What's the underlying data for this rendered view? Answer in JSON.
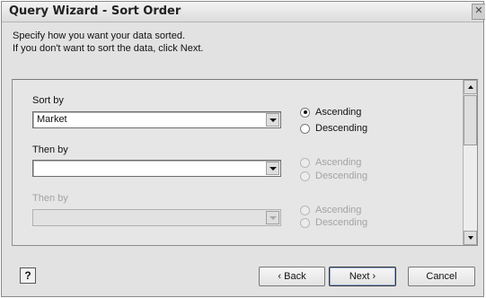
{
  "window": {
    "title": "Query Wizard - Sort Order",
    "close_glyph": "✕"
  },
  "instructions": {
    "line1": "Specify how you want your data sorted.",
    "line2": "If you don't want to sort the data, click Next."
  },
  "sort_levels": [
    {
      "label": "Sort by",
      "value": "Market",
      "enabled": true,
      "order": "Ascending"
    },
    {
      "label": "Then by",
      "value": "",
      "enabled": true,
      "order": "none"
    },
    {
      "label": "Then by",
      "value": "",
      "enabled": false,
      "order": "none"
    }
  ],
  "order_options": {
    "ascending": "Ascending",
    "descending": "Descending"
  },
  "buttons": {
    "back": "‹ Back",
    "next": "Next ›",
    "cancel": "Cancel",
    "help_glyph": "?"
  },
  "icons": [
    "close-icon",
    "help-icon",
    "dropdown-arrow-icon",
    "scroll-up-arrow-icon",
    "scroll-down-arrow-icon"
  ]
}
